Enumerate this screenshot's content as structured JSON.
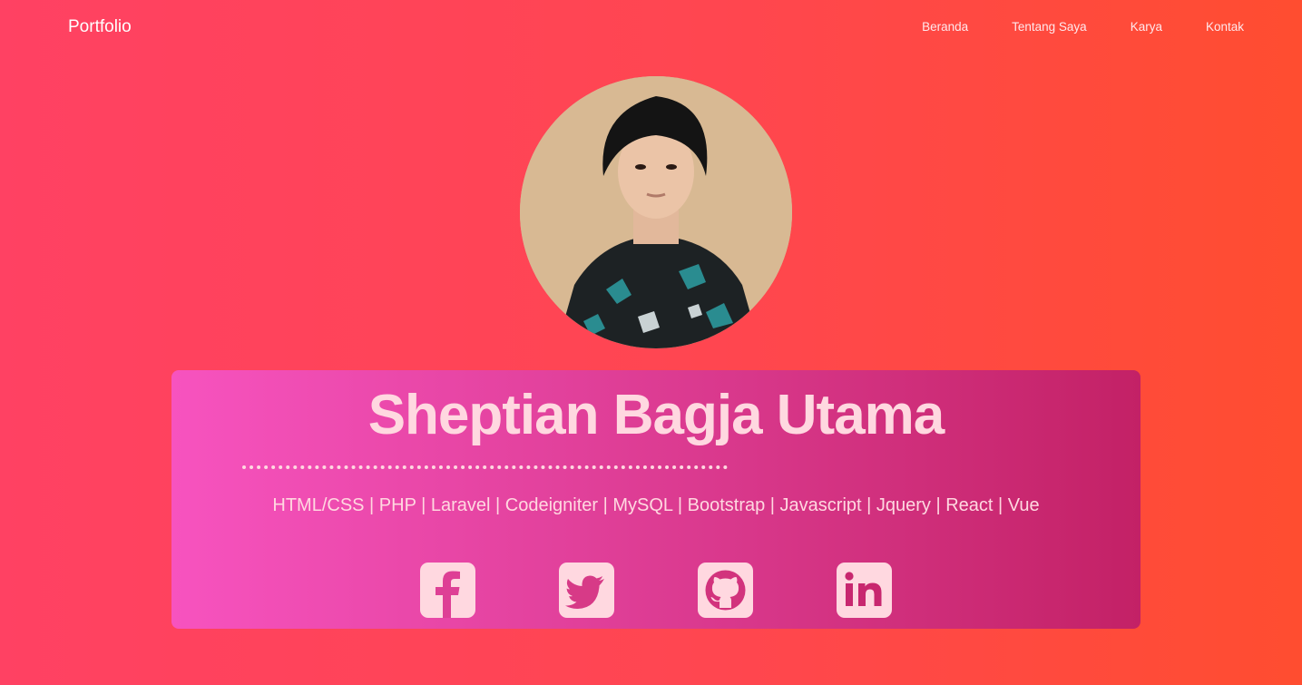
{
  "nav": {
    "brand": "Portfolio",
    "links": [
      "Beranda",
      "Tentang Saya",
      "Karya",
      "Kontak"
    ]
  },
  "profile": {
    "photo": "profile-photo",
    "name": "Sheptian Bagja Utama",
    "skills": "HTML/CSS | PHP | Laravel | Codeigniter | MySQL | Bootstrap | Javascript | Jquery | React | Vue"
  },
  "social": [
    "facebook-icon",
    "twitter-icon",
    "github-icon",
    "linkedin-icon"
  ],
  "colors": {
    "background_start": "#ff4163",
    "background_end": "#ff4d30",
    "card_start": "#f753bf",
    "card_end": "#c32166",
    "accent_text": "#ffd8e0"
  }
}
